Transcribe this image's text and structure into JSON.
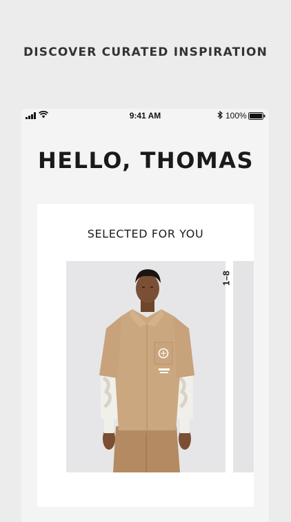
{
  "headline": "DISCOVER CURATED INSPIRATION",
  "status_bar": {
    "time": "9:41 AM",
    "battery": "100%"
  },
  "greeting": "HELLO, THOMAS",
  "selected_section": {
    "title": "SELECTED FOR YOU",
    "counter": "1–8"
  },
  "icons": {
    "signal": "cellular-signal-icon",
    "wifi": "wifi-icon",
    "bluetooth": "bluetooth-icon",
    "battery": "battery-icon"
  }
}
